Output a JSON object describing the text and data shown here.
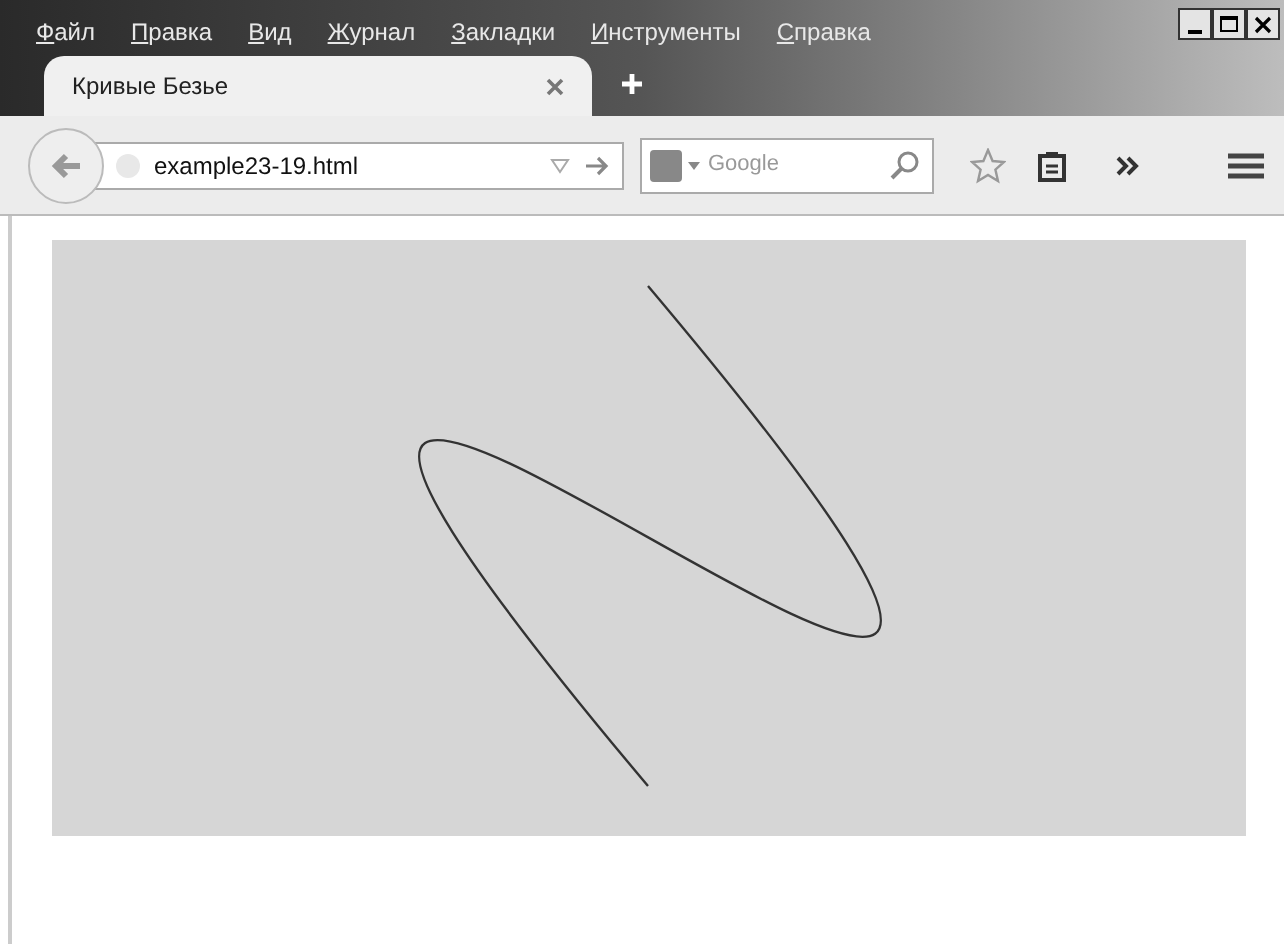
{
  "menu": [
    "Файл",
    "Правка",
    "Вид",
    "Журнал",
    "Закладки",
    "Инструменты",
    "Справка"
  ],
  "tabs": [
    {
      "label": "Кривые Безье",
      "selected": true
    }
  ],
  "address": {
    "value": "example23-19.html"
  },
  "search": {
    "placeholder": "Google"
  }
}
